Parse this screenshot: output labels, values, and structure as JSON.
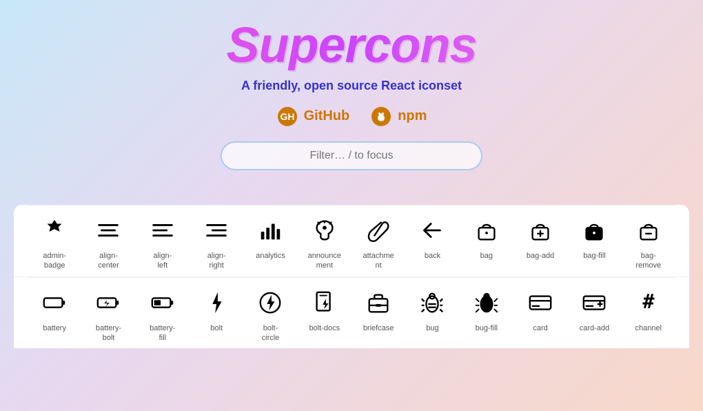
{
  "hero": {
    "title": "Supercons",
    "subtitle": "A friendly, open source React iconset",
    "github_label": "GitHub",
    "npm_label": "npm",
    "search_placeholder": "Filter… / to focus"
  },
  "icon_rows": [
    [
      {
        "name": "admin-badge",
        "label": "admin-\nbadge"
      },
      {
        "name": "align-center",
        "label": "align-\ncenter"
      },
      {
        "name": "align-left",
        "label": "align-\nleft"
      },
      {
        "name": "align-right",
        "label": "align-\nright"
      },
      {
        "name": "analytics",
        "label": "analytics"
      },
      {
        "name": "announcement",
        "label": "announce\nment"
      },
      {
        "name": "attachment",
        "label": "attachme\nnt"
      },
      {
        "name": "back",
        "label": "back"
      },
      {
        "name": "bag",
        "label": "bag"
      },
      {
        "name": "bag-add",
        "label": "bag-add"
      },
      {
        "name": "bag-fill",
        "label": "bag-fill"
      },
      {
        "name": "bag-remove",
        "label": "bag-\nremove"
      }
    ],
    [
      {
        "name": "battery",
        "label": "battery"
      },
      {
        "name": "battery-bolt",
        "label": "battery-\nbolt"
      },
      {
        "name": "battery-fill",
        "label": "battery-\nfill"
      },
      {
        "name": "bolt",
        "label": "bolt"
      },
      {
        "name": "bolt-circle",
        "label": "bolt-\ncircle"
      },
      {
        "name": "bolt-docs",
        "label": "bolt-docs"
      },
      {
        "name": "briefcase",
        "label": "briefcase"
      },
      {
        "name": "bug",
        "label": "bug"
      },
      {
        "name": "bug-fill",
        "label": "bug-fill"
      },
      {
        "name": "card",
        "label": "card"
      },
      {
        "name": "card-add",
        "label": "card-add"
      },
      {
        "name": "channel",
        "label": "channel"
      }
    ]
  ]
}
